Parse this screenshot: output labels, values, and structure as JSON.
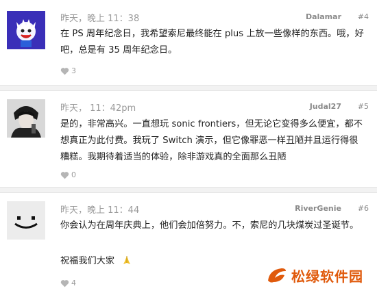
{
  "posts": [
    {
      "time": "昨天，晚上 11：38",
      "user": "Dalamar",
      "num": "#4",
      "text": "在 PS 周年纪念日，我希望索尼最终能在 plus 上放一些像样的东西。哦，好吧，总是有 35 周年纪念日。",
      "likes": "3",
      "avatar_icon": "jack-frost-avatar-icon"
    },
    {
      "time": "昨天，  11：42pm",
      "user": "Judal27",
      "num": "#5",
      "text": "是的，非常高兴。一直想玩 sonic frontiers，但无论它变得多么便宜，都不想真正为此付费。我玩了 Switch 演示，但它像罪恶一样丑陋并且运行得很糟糕。我期待着适当的体验，除非游戏真的全面那么丑陋",
      "likes": "0",
      "avatar_icon": "dark-character-avatar-icon"
    },
    {
      "time": "昨天，晚上 11：44",
      "user": "RiverGenie",
      "num": "#6",
      "text": "你会认为在周年庆典上，他们会加倍努力。不，索尼的几块煤炭过圣诞节。",
      "text2": "祝福我们大家",
      "likes": "4",
      "avatar_icon": "smiley-face-avatar-icon"
    }
  ],
  "watermark": {
    "text": "松绿软件园",
    "icon": "leaf-logo-icon"
  },
  "colors": {
    "meta": "#9a9a9a",
    "divider": "#f2f2f2",
    "brand": "#e05a0c"
  }
}
